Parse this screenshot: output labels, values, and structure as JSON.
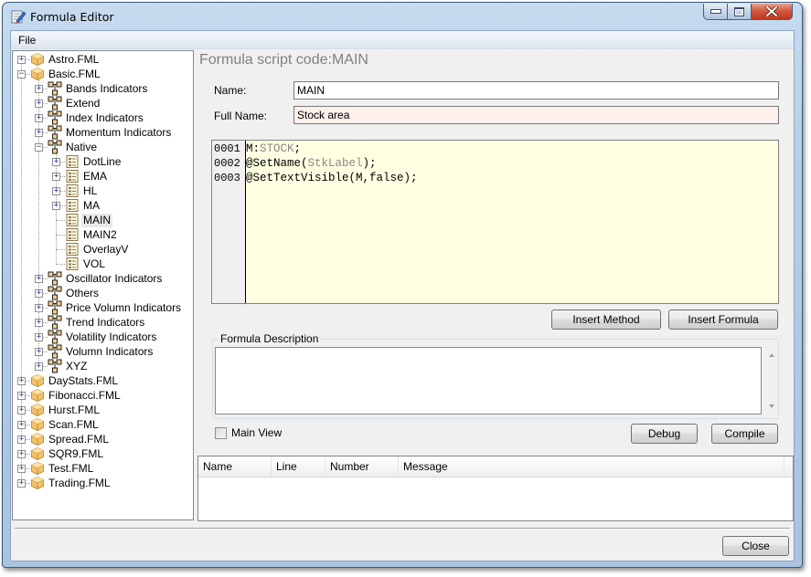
{
  "window": {
    "title": "Formula Editor",
    "controls": {
      "minimize": "minimize",
      "maximize": "maximize",
      "close": "close"
    }
  },
  "menu": {
    "items": [
      {
        "label": "File"
      }
    ]
  },
  "tree": {
    "items": [
      {
        "label": "Astro.FML",
        "level": 0,
        "icon": "package-icon",
        "expander": "plus"
      },
      {
        "label": "Basic.FML",
        "level": 0,
        "icon": "package-icon",
        "expander": "minus"
      },
      {
        "label": "Bands Indicators",
        "level": 1,
        "icon": "hierarchy-icon",
        "expander": "plus"
      },
      {
        "label": "Extend",
        "level": 1,
        "icon": "hierarchy-icon",
        "expander": "plus"
      },
      {
        "label": "Index Indicators",
        "level": 1,
        "icon": "hierarchy-icon",
        "expander": "plus"
      },
      {
        "label": "Momentum Indicators",
        "level": 1,
        "icon": "hierarchy-icon",
        "expander": "plus"
      },
      {
        "label": "Native",
        "level": 1,
        "icon": "hierarchy-icon",
        "expander": "minus"
      },
      {
        "label": "DotLine",
        "level": 2,
        "icon": "formula-icon",
        "expander": "plus"
      },
      {
        "label": "EMA",
        "level": 2,
        "icon": "formula-icon",
        "expander": "plus"
      },
      {
        "label": "HL",
        "level": 2,
        "icon": "formula-icon",
        "expander": "plus"
      },
      {
        "label": "MA",
        "level": 2,
        "icon": "formula-icon",
        "expander": "plus"
      },
      {
        "label": "MAIN",
        "level": 2,
        "icon": "formula-icon",
        "expander": "none",
        "selected": true
      },
      {
        "label": "MAIN2",
        "level": 2,
        "icon": "formula-icon",
        "expander": "none"
      },
      {
        "label": "OverlayV",
        "level": 2,
        "icon": "formula-icon",
        "expander": "none"
      },
      {
        "label": "VOL",
        "level": 2,
        "icon": "formula-icon",
        "expander": "none"
      },
      {
        "label": "Oscillator Indicators",
        "level": 1,
        "icon": "hierarchy-icon",
        "expander": "plus"
      },
      {
        "label": "Others",
        "level": 1,
        "icon": "hierarchy-icon",
        "expander": "plus"
      },
      {
        "label": "Price Volumn Indicators",
        "level": 1,
        "icon": "hierarchy-icon",
        "expander": "plus"
      },
      {
        "label": "Trend Indicators",
        "level": 1,
        "icon": "hierarchy-icon",
        "expander": "plus"
      },
      {
        "label": "Volatility Indicators",
        "level": 1,
        "icon": "hierarchy-icon",
        "expander": "plus"
      },
      {
        "label": "Volumn Indicators",
        "level": 1,
        "icon": "hierarchy-icon",
        "expander": "plus"
      },
      {
        "label": "XYZ",
        "level": 1,
        "icon": "hierarchy-icon",
        "expander": "plus"
      },
      {
        "label": "DayStats.FML",
        "level": 0,
        "icon": "package-icon",
        "expander": "plus"
      },
      {
        "label": "Fibonacci.FML",
        "level": 0,
        "icon": "package-icon",
        "expander": "plus"
      },
      {
        "label": "Hurst.FML",
        "level": 0,
        "icon": "package-icon",
        "expander": "plus"
      },
      {
        "label": "Scan.FML",
        "level": 0,
        "icon": "package-icon",
        "expander": "plus"
      },
      {
        "label": "Spread.FML",
        "level": 0,
        "icon": "package-icon",
        "expander": "plus"
      },
      {
        "label": "SQR9.FML",
        "level": 0,
        "icon": "package-icon",
        "expander": "plus"
      },
      {
        "label": "Test.FML",
        "level": 0,
        "icon": "package-icon",
        "expander": "plus"
      },
      {
        "label": "Trading.FML",
        "level": 0,
        "icon": "package-icon",
        "expander": "plus"
      }
    ]
  },
  "editor": {
    "header": "Formula script code:MAIN",
    "name_label": "Name:",
    "name_value": "MAIN",
    "fullname_label": "Full Name:",
    "fullname_value": "Stock area",
    "code_lines": [
      {
        "num": "0001",
        "tokens": [
          {
            "t": "M:",
            "c": "plain"
          },
          {
            "t": "STOCK",
            "c": "gray"
          },
          {
            "t": ";",
            "c": "plain"
          }
        ]
      },
      {
        "num": "0002",
        "tokens": [
          {
            "t": "@SetName(",
            "c": "plain"
          },
          {
            "t": "StkLabel",
            "c": "gray"
          },
          {
            "t": ");",
            "c": "plain"
          }
        ]
      },
      {
        "num": "0003",
        "tokens": [
          {
            "t": "@SetTextVisible(M,false);",
            "c": "plain"
          }
        ]
      }
    ],
    "insert_method_label": "Insert Method",
    "insert_formula_label": "Insert Formula",
    "description_legend": "Formula Description",
    "description_value": "",
    "main_view_label": "Main View",
    "main_view_checked": false,
    "debug_label": "Debug",
    "compile_label": "Compile"
  },
  "messages": {
    "columns": [
      {
        "label": "Name"
      },
      {
        "label": "Line"
      },
      {
        "label": "Number"
      },
      {
        "label": "Message"
      }
    ],
    "rows": []
  },
  "footer": {
    "close_label": "Close"
  },
  "colors": {
    "code_background": "#ffffe1",
    "fullname_background": "#fef0ec",
    "syntax_gray": "#888888"
  }
}
